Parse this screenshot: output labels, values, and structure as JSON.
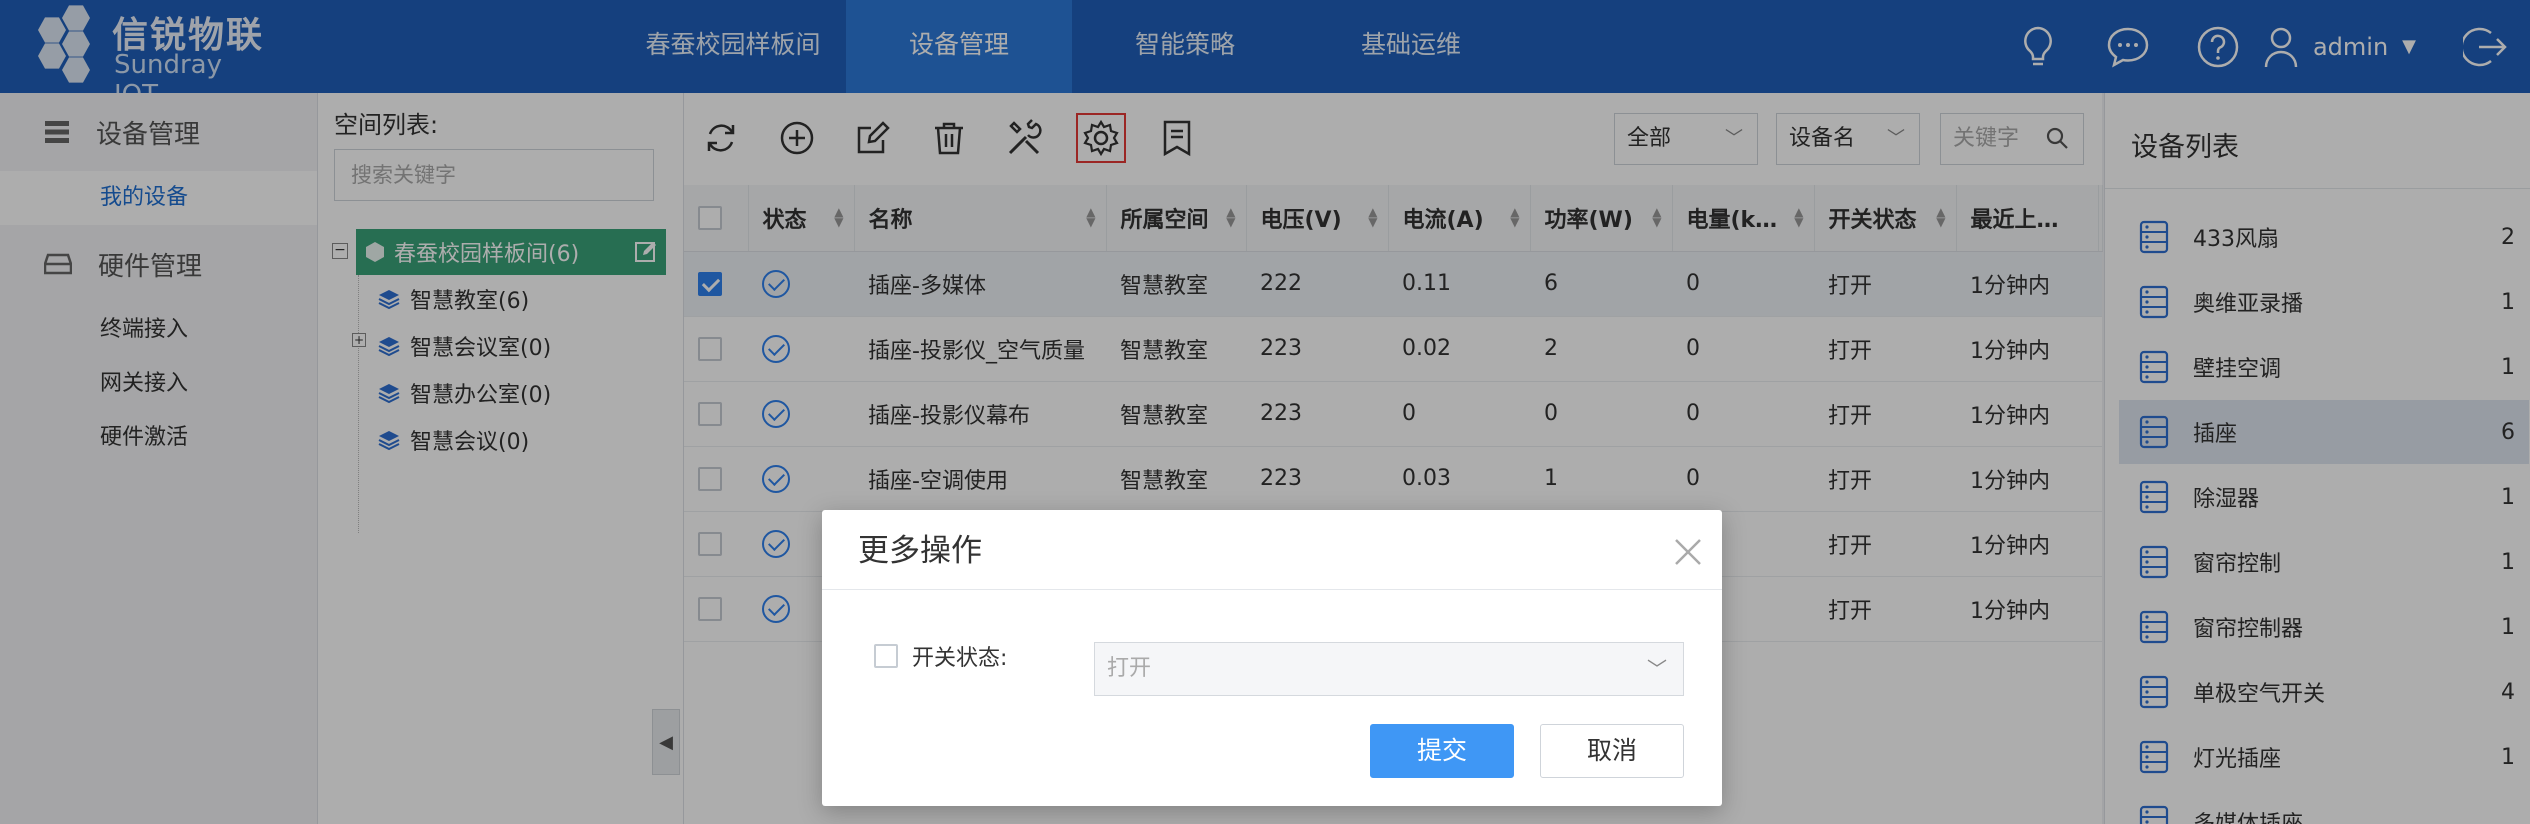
{
  "header": {
    "logo_cn": "信锐物联",
    "logo_en": "Sundray IOT",
    "nav": [
      {
        "label": "春蚕校园样板间",
        "active": false
      },
      {
        "label": "设备管理",
        "active": true
      },
      {
        "label": "智能策略",
        "active": false
      },
      {
        "label": "基础运维",
        "active": false
      }
    ],
    "user": "admin",
    "icons": [
      "lightbulb-icon",
      "chat-icon",
      "help-icon",
      "user-icon",
      "logout-icon"
    ]
  },
  "sidebar": {
    "groups": [
      {
        "label": "设备管理",
        "icon": "menu-list-icon",
        "items": [
          {
            "label": "我的设备",
            "active": true
          }
        ]
      },
      {
        "label": "硬件管理",
        "icon": "hardware-icon",
        "items": [
          {
            "label": "终端接入"
          },
          {
            "label": "网关接入"
          },
          {
            "label": "硬件激活"
          }
        ]
      }
    ]
  },
  "tree": {
    "title": "空间列表:",
    "search_placeholder": "搜索关键字",
    "root": "春蚕校园样板间(6)",
    "nodes": [
      {
        "label": "智慧教室(6)",
        "expandable": false
      },
      {
        "label": "智慧会议室(0)",
        "expandable": true
      },
      {
        "label": "智慧办公室(0)",
        "expandable": false
      },
      {
        "label": "智慧会议(0)",
        "expandable": false
      }
    ]
  },
  "toolbar": {
    "buttons": [
      "refresh-icon",
      "add-icon",
      "edit-icon",
      "delete-icon",
      "tools-icon",
      "settings-icon",
      "bookmark-icon"
    ],
    "filter_scope": "全部",
    "filter_field": "设备名",
    "keyword_placeholder": "关键字"
  },
  "table": {
    "columns": [
      "状态",
      "名称",
      "所属空间",
      "电压(V)",
      "电流(A)",
      "功率(W)",
      "电量(k…",
      "开关状态",
      "最近上…"
    ],
    "rows": [
      {
        "checked": true,
        "name": "插座-多媒体",
        "space": "智慧教室",
        "voltage": "222",
        "current": "0.11",
        "power": "6",
        "energy": "0",
        "switch": "打开",
        "last": "1分钟内"
      },
      {
        "checked": false,
        "name": "插座-投影仪_空气质量",
        "space": "智慧教室",
        "voltage": "223",
        "current": "0.02",
        "power": "2",
        "energy": "0",
        "switch": "打开",
        "last": "1分钟内"
      },
      {
        "checked": false,
        "name": "插座-投影仪幕布",
        "space": "智慧教室",
        "voltage": "223",
        "current": "0",
        "power": "0",
        "energy": "0",
        "switch": "打开",
        "last": "1分钟内"
      },
      {
        "checked": false,
        "name": "插座-空调使用",
        "space": "智慧教室",
        "voltage": "223",
        "current": "0.03",
        "power": "1",
        "energy": "0",
        "switch": "打开",
        "last": "1分钟内"
      },
      {
        "checked": false,
        "name": "",
        "space": "",
        "voltage": "",
        "current": "",
        "power": "",
        "energy": "",
        "switch": "打开",
        "last": "1分钟内"
      },
      {
        "checked": false,
        "name": "",
        "space": "",
        "voltage": "",
        "current": "",
        "power": "",
        "energy": "",
        "switch": "打开",
        "last": "1分钟内"
      }
    ]
  },
  "device_list": {
    "title": "设备列表",
    "items": [
      {
        "name": "433风扇",
        "count": "2"
      },
      {
        "name": "奥维亚录播",
        "count": "1"
      },
      {
        "name": "壁挂空调",
        "count": "1"
      },
      {
        "name": "插座",
        "count": "6",
        "active": true
      },
      {
        "name": "除湿器",
        "count": "1"
      },
      {
        "name": "窗帘控制",
        "count": "1"
      },
      {
        "name": "窗帘控制器",
        "count": "1"
      },
      {
        "name": "单极空气开关",
        "count": "4"
      },
      {
        "name": "灯光插座",
        "count": "1"
      },
      {
        "name": "多媒体插座",
        "count": ""
      }
    ]
  },
  "modal": {
    "title": "更多操作",
    "field_label": "开关状态:",
    "field_value": "打开",
    "submit": "提交",
    "cancel": "取消"
  },
  "colors": {
    "header_bg": "#1f5fba",
    "nav_active": "#2d7ad9",
    "tree_root_bg": "#3aa37a",
    "primary_button": "#3f97f5",
    "link": "#2f6fd1",
    "highlight_border": "#e53935"
  }
}
